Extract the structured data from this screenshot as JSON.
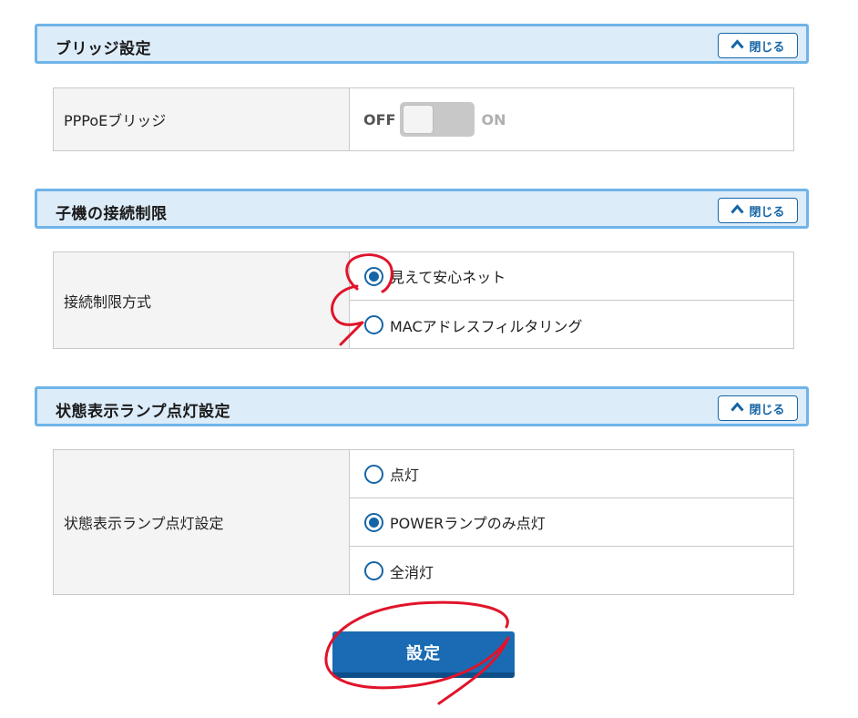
{
  "bridge_section": {
    "title": "ブリッジ設定",
    "close_label": "閉じる",
    "row_label": "PPPoEブリッジ",
    "toggle_off": "OFF",
    "toggle_on": "ON",
    "toggle_state": "OFF"
  },
  "restriction_section": {
    "title": "子機の接続制限",
    "close_label": "閉じる",
    "row_label": "接続制限方式",
    "options": [
      {
        "label": "見えて安心ネット",
        "selected": true
      },
      {
        "label": "MACアドレスフィルタリング",
        "selected": false
      }
    ]
  },
  "lamp_section": {
    "title": "状態表示ランプ点灯設定",
    "close_label": "閉じる",
    "row_label": "状態表示ランプ点灯設定",
    "options": [
      {
        "label": "点灯",
        "selected": false
      },
      {
        "label": "POWERランプのみ点灯",
        "selected": true
      },
      {
        "label": "全消灯",
        "selected": false
      }
    ]
  },
  "submit_label": "設定",
  "colors": {
    "accent": "#1565a6",
    "header_bg": "#ddecf9",
    "header_border": "#6fb4e8",
    "annotation": "#e0142a"
  }
}
